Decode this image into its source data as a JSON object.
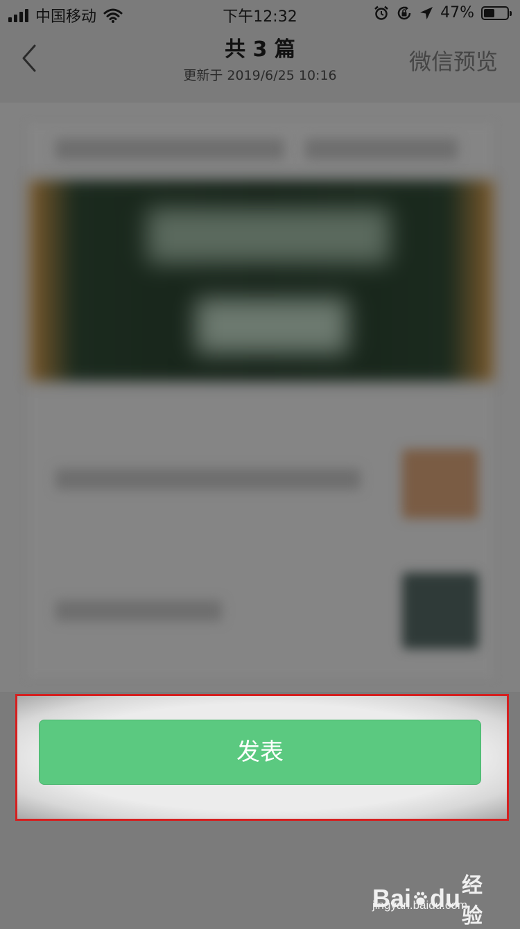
{
  "status_bar": {
    "carrier": "中国移动",
    "time": "下午12:32",
    "battery_percent": "47%",
    "battery_level": 0.47,
    "icons": [
      "signal-icon",
      "wifi-icon",
      "alarm-icon",
      "rotation-lock-icon",
      "location-icon",
      "battery-icon"
    ]
  },
  "nav": {
    "title": "共 3 篇",
    "subtitle": "更新于 2019/6/25 10:16",
    "back_icon": "chevron-left-icon",
    "preview_label": "微信预览"
  },
  "bottom": {
    "publish_label": "发表",
    "publish_color": "#5bc980",
    "highlight_color": "#d42020"
  },
  "watermark": {
    "brand_left": "Bai",
    "brand_right": "du",
    "suffix": "经验",
    "url": "jingyan.baidu.com"
  }
}
